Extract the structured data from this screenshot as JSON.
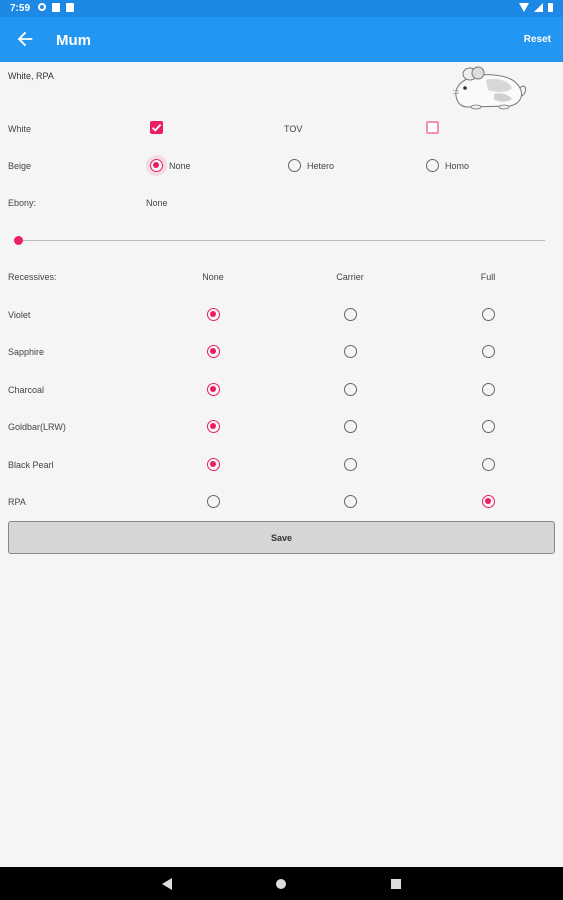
{
  "status": {
    "time": "7:59"
  },
  "appbar": {
    "title": "Mum",
    "reset_label": "Reset"
  },
  "summary": "White, RPA",
  "colors": {
    "primary": "#2196f3",
    "accent": "#e91e63"
  },
  "white": {
    "label": "White",
    "checked": true
  },
  "tov": {
    "label": "TOV",
    "checked": false
  },
  "beige": {
    "label": "Beige",
    "options": [
      "None",
      "Hetero",
      "Homo"
    ],
    "selected": "None"
  },
  "ebony": {
    "label": "Ebony:",
    "value": "None",
    "slider_level": 0
  },
  "recessives": {
    "label": "Recessives:",
    "columns": [
      "None",
      "Carrier",
      "Full"
    ],
    "rows": [
      {
        "name": "Violet",
        "selected": "None"
      },
      {
        "name": "Sapphire",
        "selected": "None"
      },
      {
        "name": "Charcoal",
        "selected": "None"
      },
      {
        "name": "Goldbar(LRW)",
        "selected": "None"
      },
      {
        "name": "Black Pearl",
        "selected": "None"
      },
      {
        "name": "RPA",
        "selected": "Full"
      }
    ]
  },
  "save_label": "Save",
  "icons": {
    "back": "arrow-back-icon",
    "chinchilla": "chinchilla-illustration",
    "nav": [
      "back-triangle-icon",
      "home-circle-icon",
      "recents-square-icon"
    ]
  }
}
